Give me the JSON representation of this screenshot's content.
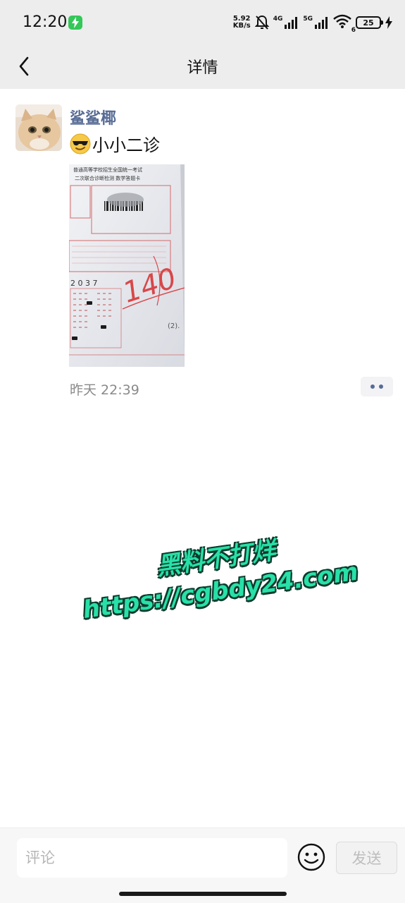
{
  "status_bar": {
    "time": "12:20",
    "net_speed_value": "5.92",
    "net_speed_unit": "KB/s",
    "network_1": "4G",
    "network_2": "5G",
    "wifi_badge": "6",
    "battery_level": "25"
  },
  "header": {
    "title": "详情",
    "back_icon": "chevron-left-icon"
  },
  "post": {
    "author": "鲨鲨椰",
    "emoji": "sunglasses-emoji",
    "text": "小小二诊",
    "timestamp": "昨天 22:39",
    "image_text": {
      "header_line1": "普通高等学校招生全国统一考试",
      "header_line2": "二次联合诊断检测  数学答题卡",
      "score": "140"
    }
  },
  "watermark": {
    "line1": "黑料不打烊",
    "line2": "https://cgbdy24.com"
  },
  "comment_bar": {
    "placeholder": "评论",
    "send_label": "发送",
    "emoji_icon": "smiley-icon"
  },
  "colors": {
    "name_link": "#576b95",
    "bar_bg": "#ededed",
    "watermark_fill": "#28e0a8",
    "watermark_outline": "#0b3b2c"
  }
}
